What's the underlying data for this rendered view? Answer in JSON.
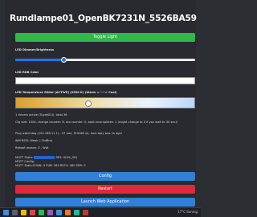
{
  "title": "Rundlampe01_OpenBK7231N_5526BA59",
  "buttons": {
    "toggle": "Toggle Light",
    "config": "Config",
    "restart": "Restart",
    "launch": "Launch Web Application"
  },
  "labels": {
    "brightness": "LED Dimmer/Brightness",
    "rgb": "LED RGB Color",
    "temperature": "LED Temperature Slider [ACTIVE] (2500 K) (Warm <-----> Cool)"
  },
  "sliders": {
    "brightness_fraction": 0.27,
    "temperature_fraction": 0.4
  },
  "info": {
    "drivers": "1 drivers active (TuyaMCU), total 36",
    "cfg": "Cfg size: 1504, change counter: 6, ota counter: 0, boot incompletes: 1 (might change to 0 if you wait to 30 sec)!",
    "ping": "Ping watchdog (192.168.11.1) - 37 lost, 315060 ok, last reply was 1s ago!",
    "wifi": "Wifi RSSI: Weak (-74dBm)",
    "reboot": "Reboot reason: 3 - Wdt",
    "mqtt_state_label": "MQTT State:",
    "mqtt_state_value": "RES: 0(OK_OK)",
    "mqtt_config": "MQTT Config:",
    "mqtt_stats": "MQTT Stats:CONN: 9 PUB: 260 RECV: 480 ERR: 0"
  },
  "tray": {
    "weather": "17°C Sonnig"
  },
  "colors": {
    "accent_green": "#2fb94a",
    "accent_blue": "#2f80d6",
    "accent_red": "#e0283a"
  }
}
